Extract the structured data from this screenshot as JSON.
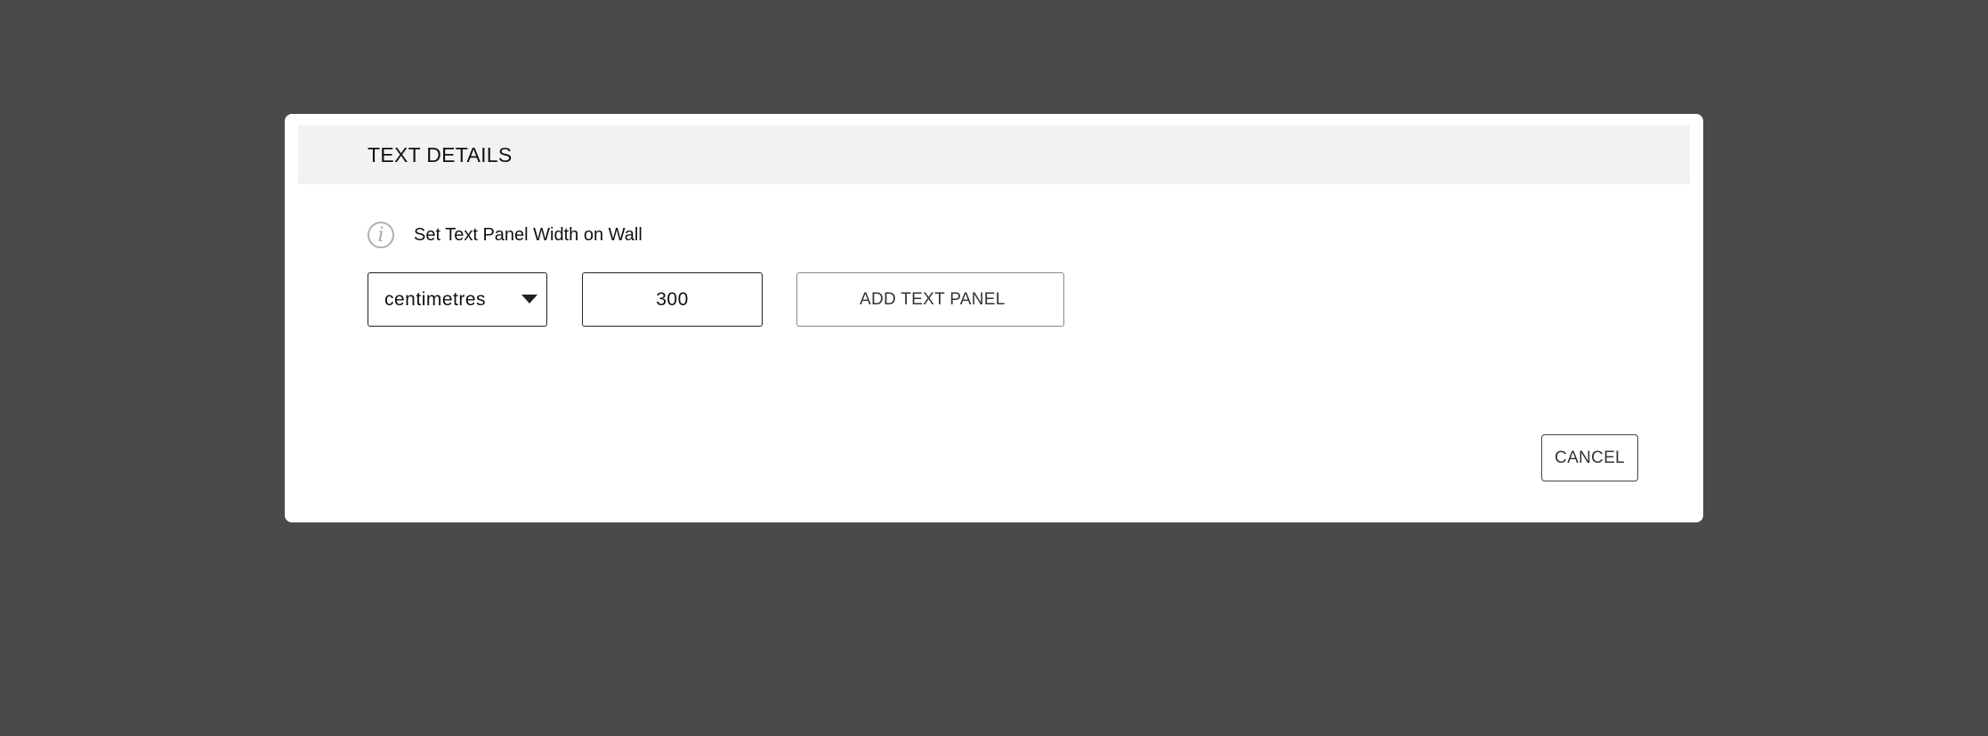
{
  "dialog": {
    "title": "TEXT DETAILS",
    "info_label": "Set Text Panel Width on Wall",
    "unit_select": {
      "selected": "centimetres"
    },
    "width_input": {
      "value": "300"
    },
    "add_button_label": "ADD TEXT PANEL",
    "cancel_button_label": "CANCEL"
  },
  "icons": {
    "info": "info-icon",
    "dropdown": "caret-down-icon",
    "cursor": "hand-pointer-click-icon"
  },
  "colors": {
    "backdrop": "#4a4a4a",
    "header_bg": "#f2f2f2",
    "dialog_bg": "#ffffff"
  }
}
